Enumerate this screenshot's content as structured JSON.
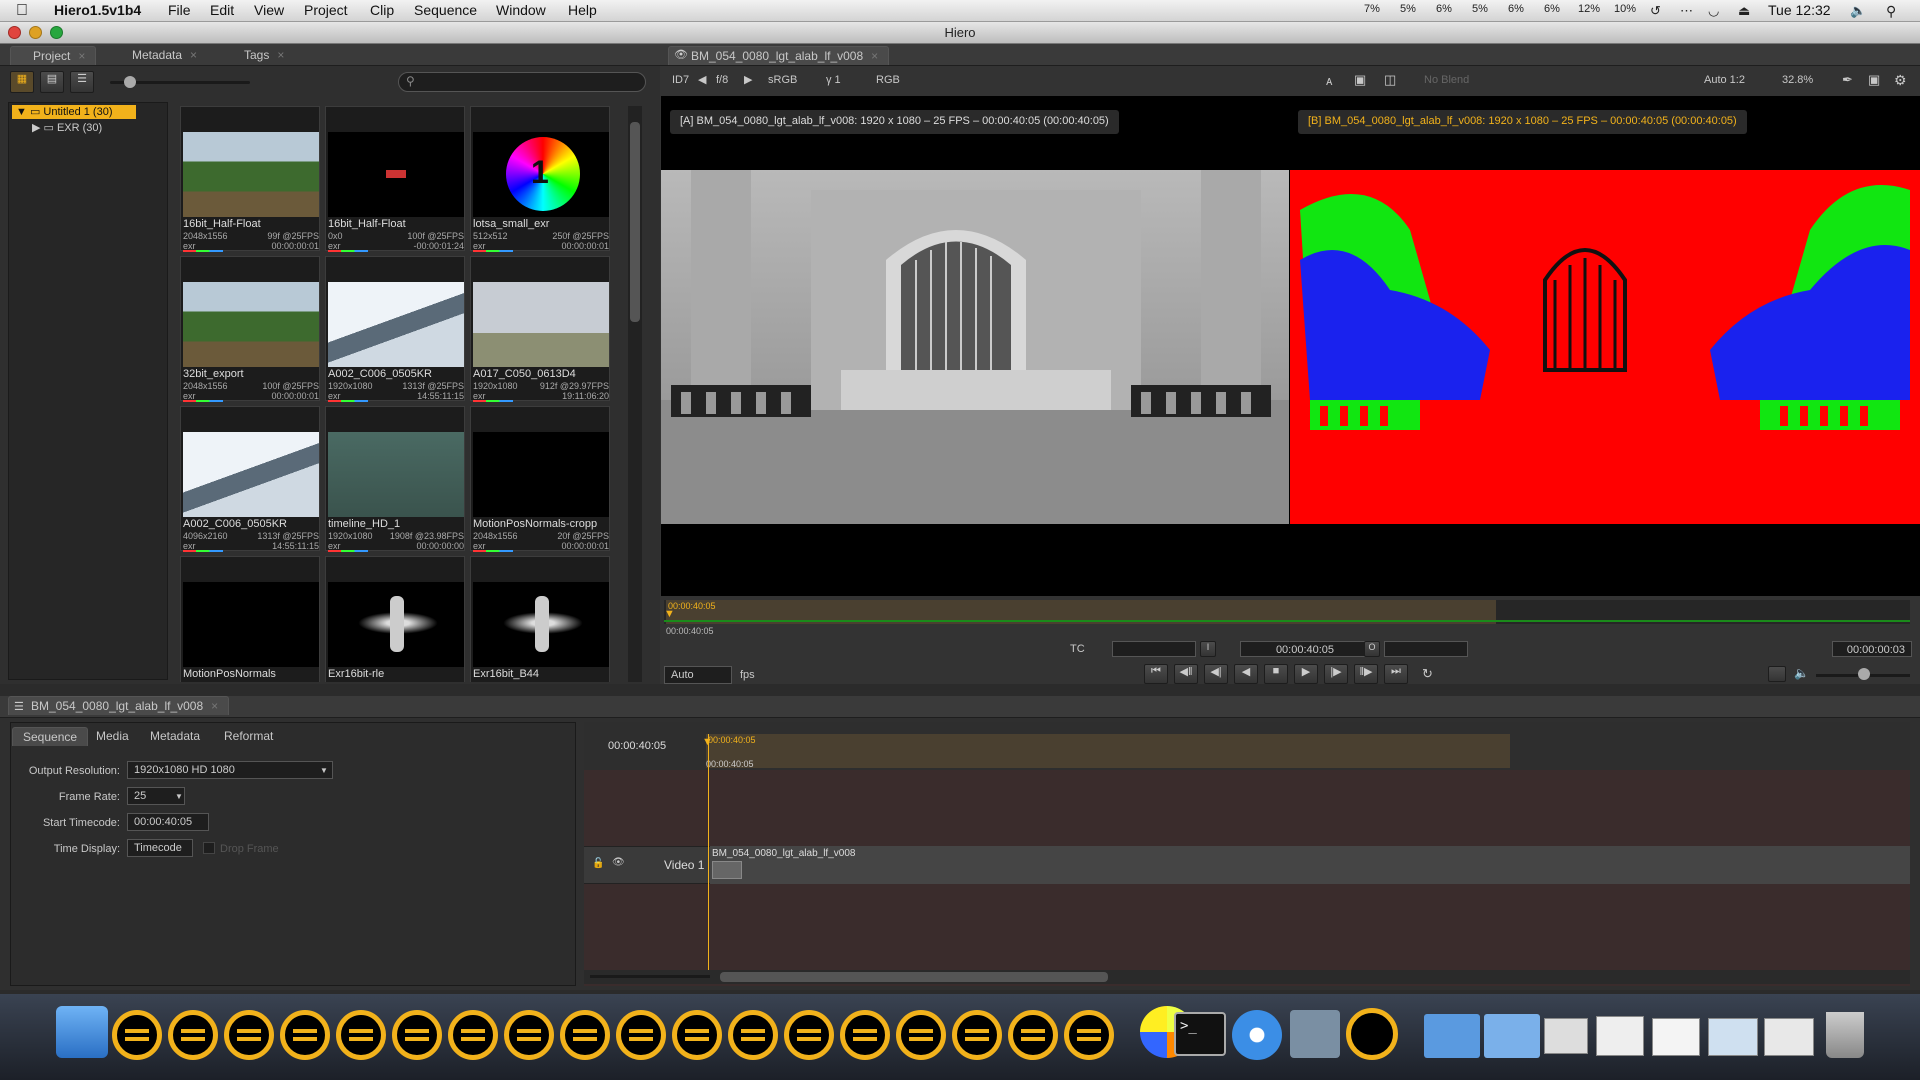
{
  "menubar": {
    "app": "Hiero1.5v1b4",
    "items": [
      "File",
      "Edit",
      "View",
      "Project",
      "Clip",
      "Sequence",
      "Window",
      "Help"
    ],
    "status": [
      "7%",
      "5%",
      "6%",
      "5%",
      "6%",
      "6%",
      "12%",
      "10%"
    ],
    "clock": "Tue 12:32"
  },
  "window": {
    "title": "Hiero"
  },
  "bin": {
    "tabs": [
      {
        "label": "Project"
      },
      {
        "label": "Metadata"
      },
      {
        "label": "Tags"
      }
    ],
    "tree": {
      "root": "Untitled 1 (30)",
      "child": "EXR (30)"
    },
    "clips": [
      {
        "name": "16bit_Half-Float",
        "res": "2048x1556",
        "info": "99f @25FPS",
        "fmt": "exr",
        "tc": "00:00:00:01",
        "art": "forest"
      },
      {
        "name": "16bit_Half-Float",
        "res": "0x0",
        "info": "100f @25FPS",
        "fmt": "exr",
        "tc": "-00:00:01:24",
        "art": "off"
      },
      {
        "name": "lotsa_small_exr",
        "res": "512x512",
        "info": "250f @25FPS",
        "fmt": "exr",
        "tc": "00:00:00:01",
        "art": "wheel"
      },
      {
        "name": "32bit_export",
        "res": "2048x1556",
        "info": "100f @25FPS",
        "fmt": "exr",
        "tc": "00:00:00:01",
        "art": "forest"
      },
      {
        "name": "A002_C006_0505KR",
        "res": "1920x1080",
        "info": "1313f @25FPS",
        "fmt": "exr",
        "tc": "14:55:11:15",
        "art": "sky"
      },
      {
        "name": "A017_C050_0613D4",
        "res": "1920x1080",
        "info": "912f @29.97FPS",
        "fmt": "exr",
        "tc": "19:11:06:20",
        "art": "girl"
      },
      {
        "name": "A002_C006_0505KR",
        "res": "4096x2160",
        "info": "1313f @25FPS",
        "fmt": "exr",
        "tc": "14:55:11:15",
        "art": "sky"
      },
      {
        "name": "timeline_HD_1",
        "res": "1920x1080",
        "info": "1908f @23.98FPS",
        "fmt": "exr",
        "tc": "00:00:00:00",
        "art": "sign"
      },
      {
        "name": "MotionPosNormals-cropp",
        "res": "2048x1556",
        "info": "20f @25FPS",
        "fmt": "exr",
        "tc": "00:00:00:01",
        "art": "dark"
      },
      {
        "name": "MotionPosNormals",
        "res": "",
        "info": "",
        "fmt": "",
        "tc": "",
        "art": "black"
      },
      {
        "name": "Exr16bit-rle",
        "res": "",
        "info": "",
        "fmt": "",
        "tc": "",
        "art": "jet"
      },
      {
        "name": "Exr16bit_B44",
        "res": "",
        "info": "",
        "fmt": "",
        "tc": "",
        "art": "jet"
      }
    ]
  },
  "viewer": {
    "tab": "BM_054_0080_lgt_alab_lf_v008",
    "toolbar": {
      "id": "ID7",
      "fstop": "f/8",
      "colorspace": "sRGB",
      "gamma": "γ 1",
      "channels": "RGB",
      "blend": "No Blend",
      "auto": "Auto 1:2",
      "zoom": "32.8%"
    },
    "labelA": "[A] BM_054_0080_lgt_alab_lf_v008: 1920 x 1080 – 25 FPS – 00:00:40:05 (00:00:40:05)",
    "labelB": "[B] BM_054_0080_lgt_alab_lf_v008: 1920 x 1080 – 25 FPS – 00:00:40:05 (00:00:40:05)",
    "scrub": {
      "tc_top": "00:00:40:05",
      "tc_bottom": "00:00:40:05"
    },
    "transport": {
      "tc_mode": "TC",
      "in": "I",
      "current": "00:00:40:05",
      "out": "O",
      "duration": "00:00:00:03",
      "fps_mode": "Auto",
      "fps_label": "fps"
    }
  },
  "sequence": {
    "tab": "BM_054_0080_lgt_alab_lf_v008",
    "subtabs": [
      "Sequence",
      "Media",
      "Metadata",
      "Reformat"
    ],
    "fields": {
      "output_resolution_label": "Output Resolution:",
      "output_resolution": "1920x1080 HD 1080",
      "frame_rate_label": "Frame Rate:",
      "frame_rate": "25",
      "start_tc_label": "Start Timecode:",
      "start_tc": "00:00:40:05",
      "time_display_label": "Time Display:",
      "time_display": "Timecode",
      "drop_frame": "Drop Frame"
    }
  },
  "timeline": {
    "tc": "00:00:40:05",
    "ruler_top": "00:00:40:05",
    "ruler_bottom": "00:00:40:05",
    "track": "Video 1",
    "clip": "BM_054_0080_lgt_alab_lf_v008"
  },
  "dock": {
    "hiero_count": 18,
    "accent": "#f2b21b"
  }
}
